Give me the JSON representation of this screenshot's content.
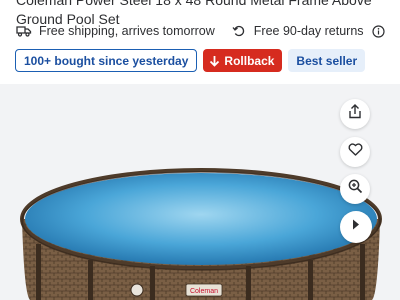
{
  "product": {
    "title_lines": [
      "Coleman Power Steel 18 x 48 Round Metal Frame Above",
      "Ground Pool Set"
    ]
  },
  "delivery": {
    "shipping_text": "Free shipping, arrives tomorrow",
    "returns_text": "Free 90-day returns"
  },
  "badges": {
    "bought": "100+ bought since yesterday",
    "rollback": "Rollback",
    "best_seller": "Best seller"
  },
  "actions": {
    "share_icon": "share-icon",
    "favorite_icon": "heart-icon",
    "zoom_icon": "zoom-in-icon",
    "next_icon": "chevron-right-icon"
  },
  "image": {
    "brand_on_pool": "Coleman"
  },
  "colors": {
    "rollback_red": "#d62b1f",
    "walmart_blue": "#1b5fb3",
    "best_seller_bg": "#e6effa"
  }
}
